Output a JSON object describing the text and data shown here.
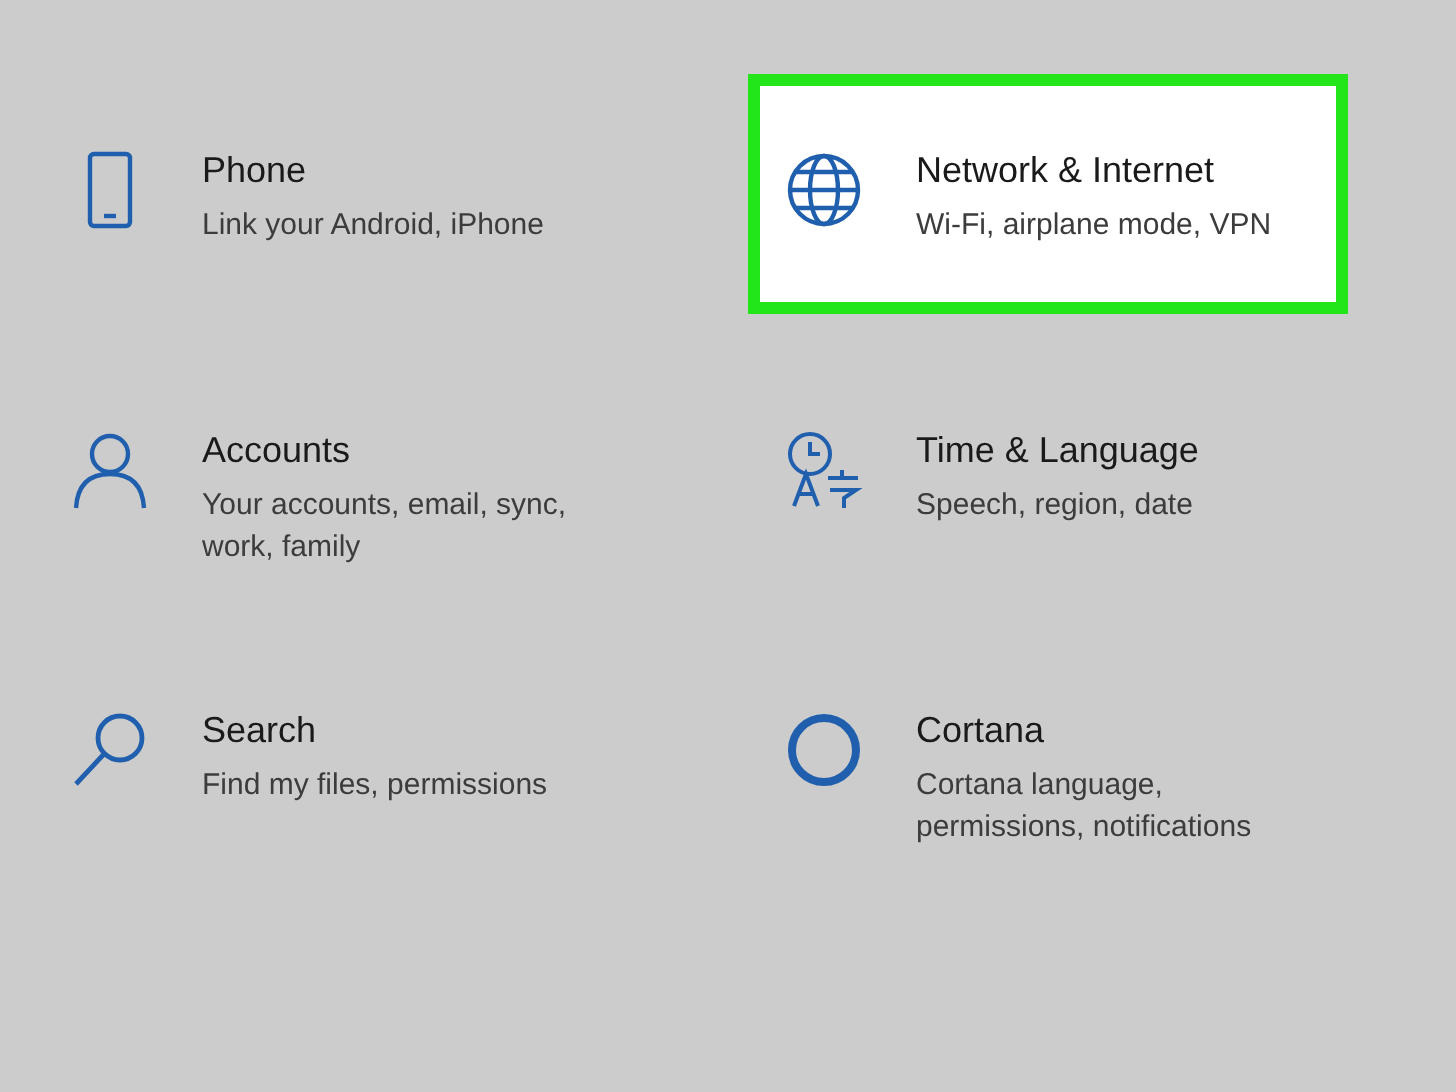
{
  "items": [
    {
      "title": "Phone",
      "subtitle": "Link your Android, iPhone",
      "selected": false
    },
    {
      "title": "Network & Internet",
      "subtitle": "Wi-Fi, airplane mode, VPN",
      "selected": true
    },
    {
      "title": "Accounts",
      "subtitle": "Your accounts, email, sync, work, family",
      "selected": false
    },
    {
      "title": "Time & Language",
      "subtitle": "Speech, region, date",
      "selected": false
    },
    {
      "title": "Search",
      "subtitle": "Find my files, permissions",
      "selected": false
    },
    {
      "title": "Cortana",
      "subtitle": "Cortana language, permissions, notifications",
      "selected": false
    }
  ]
}
